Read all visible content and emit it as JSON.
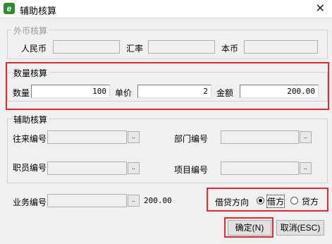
{
  "window": {
    "title": "辅助核算",
    "app_icon": "e",
    "close_glyph": "✕"
  },
  "foreign": {
    "legend": "外币核算",
    "rmb_label": "人民币",
    "rmb_value": "",
    "rate_label": "汇率",
    "rate_value": "",
    "local_label": "本币",
    "local_value": ""
  },
  "quantity": {
    "legend": "数量核算",
    "qty_label": "数量",
    "qty_value": "100",
    "price_label": "单价",
    "price_value": "2",
    "amount_label": "金额",
    "amount_value": "200.00"
  },
  "aux": {
    "legend": "辅助核算",
    "contact_label": "往来编号",
    "contact_value": "",
    "dept_label": "部门编号",
    "dept_value": "",
    "staff_label": "职员编号",
    "staff_value": "",
    "project_label": "项目编号",
    "project_value": "",
    "browse_glyph": ".."
  },
  "business": {
    "label": "业务编号",
    "value": "",
    "amount": "200.00"
  },
  "direction": {
    "label": "借贷方向",
    "debit": "借方",
    "credit": "贷方",
    "selected": "debit"
  },
  "buttons": {
    "ok": "确定(N)",
    "cancel": "取消(ESC)"
  },
  "highlight_color": "#e8282d"
}
